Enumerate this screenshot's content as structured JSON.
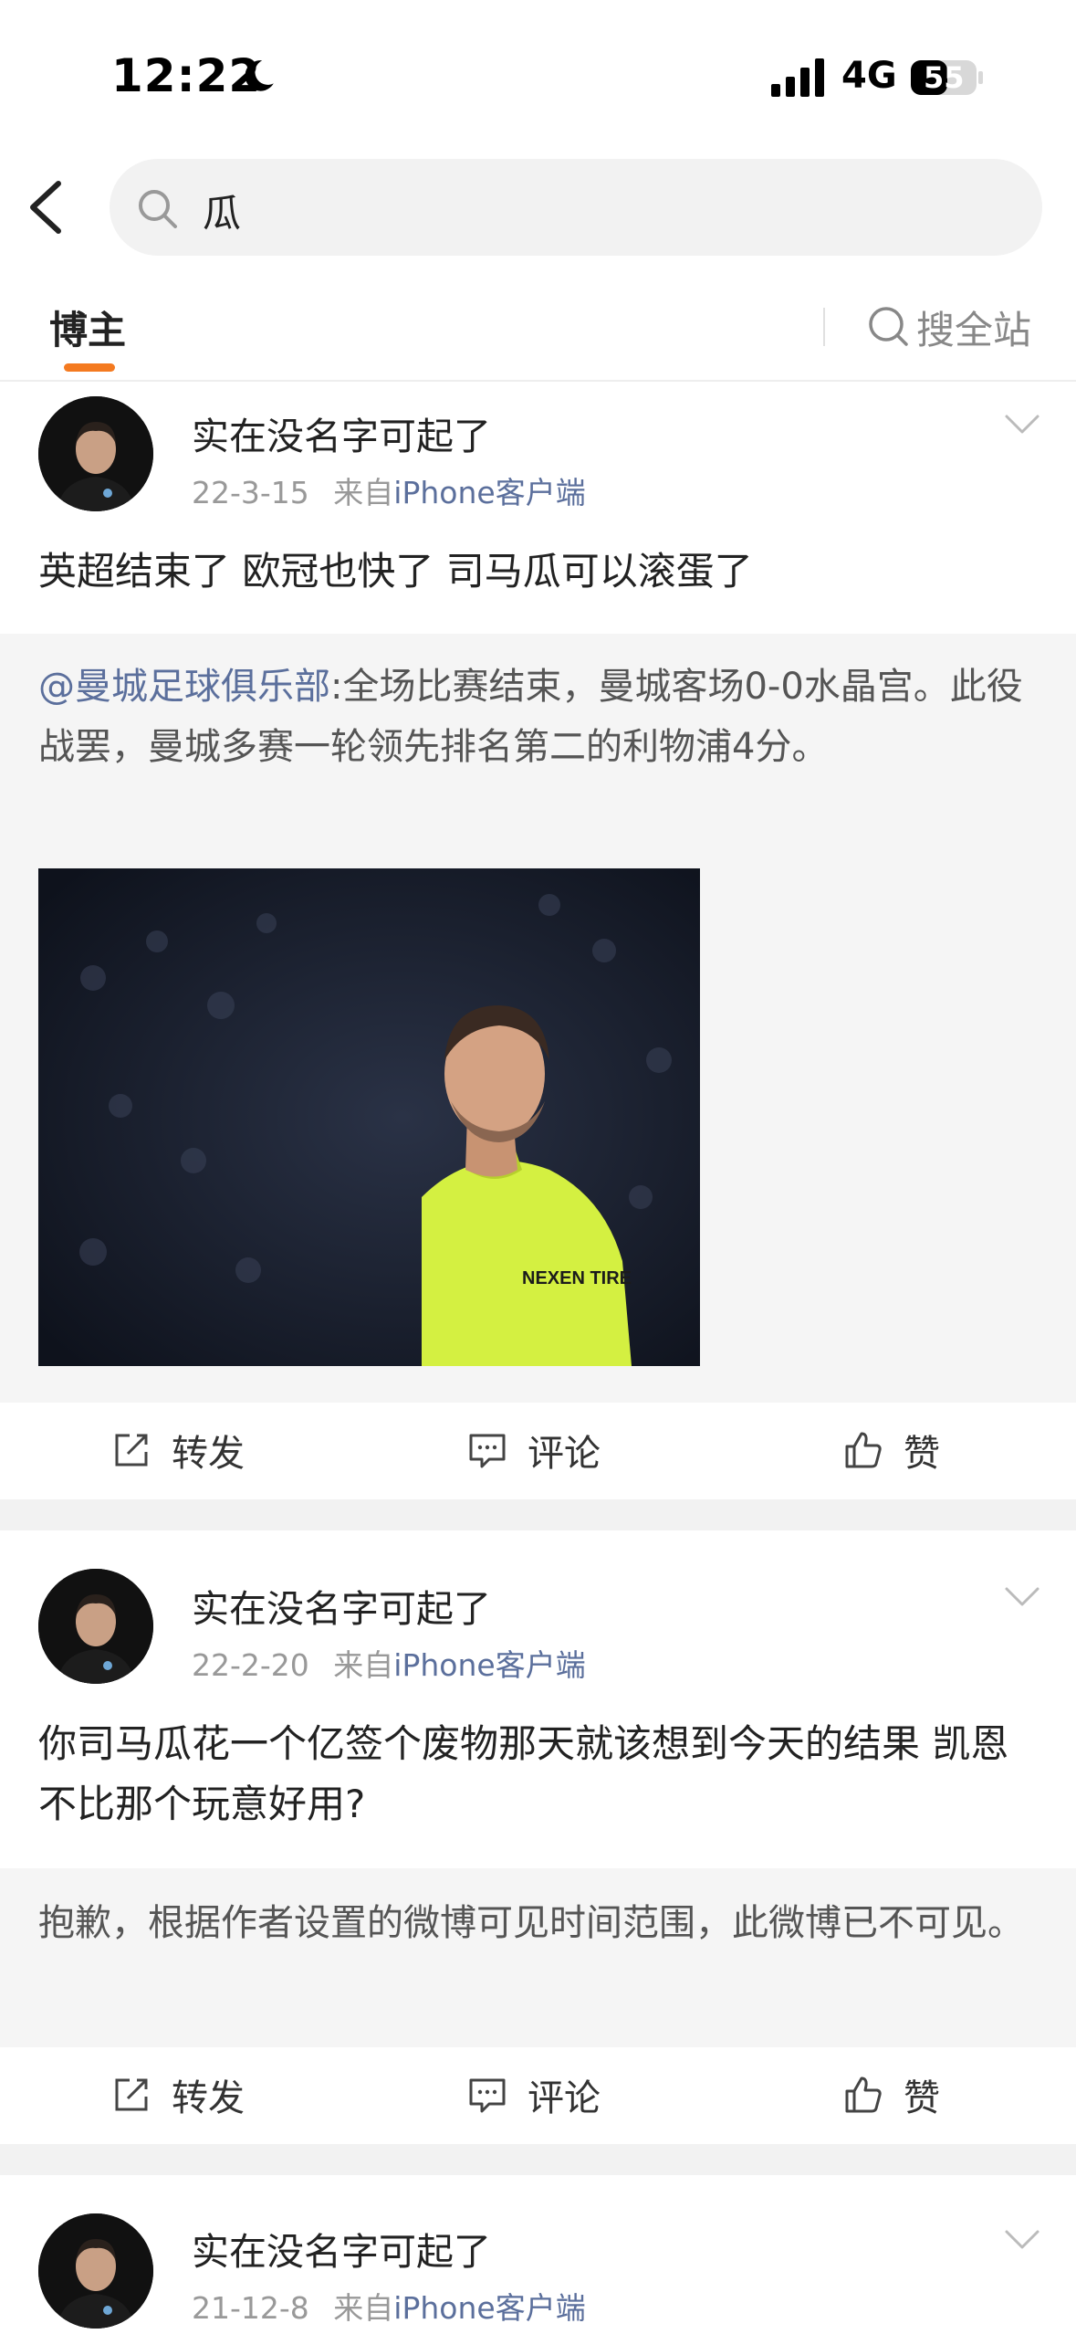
{
  "status": {
    "time": "12:22",
    "network": "4G",
    "battery": "55"
  },
  "search": {
    "query": "瓜"
  },
  "tabs": {
    "active": "博主",
    "sitewide": "搜全站"
  },
  "posts": [
    {
      "author": "实在没名字可起了",
      "date": "22-3-15",
      "source_prefix": "来自",
      "source": "iPhone客户端",
      "text": "英超结束了 欧冠也快了 司马瓜可以滚蛋了",
      "repost": {
        "mention": "@曼城足球俱乐部",
        "text": ":全场比赛结束，曼城客场0-0水晶宫。此役战罢，曼城多赛一轮领先排名第二的利物浦4分。",
        "image_desc": "photo",
        "jersey_text": "NEXEN TIRE"
      },
      "actions": {
        "repost": "转发",
        "comment": "评论",
        "like": "赞"
      }
    },
    {
      "author": "实在没名字可起了",
      "date": "22-2-20",
      "source_prefix": "来自",
      "source": "iPhone客户端",
      "text": "你司马瓜花一个亿签个废物那天就该想到今天的结果 凯恩不比那个玩意好用?",
      "repost": {
        "text": "抱歉，根据作者设置的微博可见时间范围，此微博已不可见。"
      },
      "actions": {
        "repost": "转发",
        "comment": "评论",
        "like": "赞"
      }
    },
    {
      "author": "实在没名字可起了",
      "date": "21-12-8",
      "source_prefix": "来自",
      "source": "iPhone客户端"
    }
  ],
  "colors": {
    "accent": "#f47a20",
    "link": "#5b6f9c",
    "jersey": "#d4f041"
  }
}
